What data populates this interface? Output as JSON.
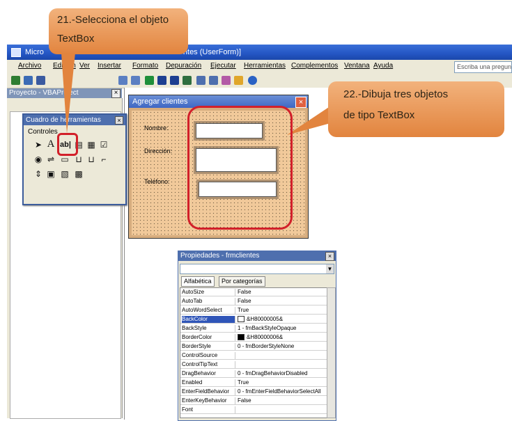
{
  "window": {
    "title": "Microsoft Visual Basic - Libro1 - [Agregar clientes (UserForm)]",
    "title_visible": "Micro",
    "title_tail": "ntes (UserForm)]"
  },
  "menu": {
    "items": [
      "Archivo",
      "Edición",
      "Ver",
      "Insertar",
      "Formato",
      "Depuración",
      "Ejecutar",
      "Herramientas",
      "Complementos",
      "Ventana",
      "Ayuda"
    ],
    "help_placeholder": "Escriba una pregunta"
  },
  "project": {
    "title": "Proyecto - VBAProject"
  },
  "toolbox": {
    "title": "Cuadro de herramientas",
    "tab": "Controles"
  },
  "form": {
    "title": "Agregar clientes",
    "labels": [
      "Nombre:",
      "Dirección:",
      "Teléfono:"
    ]
  },
  "properties": {
    "title": "Propiedades - frmclientes",
    "tabs": [
      "Alfabética",
      "Por categorías"
    ],
    "rows": [
      {
        "name": "AutoSize",
        "value": "False"
      },
      {
        "name": "AutoTab",
        "value": "False"
      },
      {
        "name": "AutoWordSelect",
        "value": "True"
      },
      {
        "name": "BackColor",
        "value": "&H80000005&"
      },
      {
        "name": "BackStyle",
        "value": "1 - fmBackStyleOpaque"
      },
      {
        "name": "BorderColor",
        "value": "&H80000006&"
      },
      {
        "name": "BorderStyle",
        "value": "0 - fmBorderStyleNone"
      },
      {
        "name": "ControlSource",
        "value": ""
      },
      {
        "name": "ControlTipText",
        "value": ""
      },
      {
        "name": "DragBehavior",
        "value": "0 - fmDragBehaviorDisabled"
      },
      {
        "name": "Enabled",
        "value": "True"
      },
      {
        "name": "EnterFieldBehavior",
        "value": "0 - fmEnterFieldBehaviorSelectAll"
      },
      {
        "name": "EnterKeyBehavior",
        "value": "False"
      },
      {
        "name": "Font",
        "value": ""
      }
    ]
  },
  "callouts": {
    "step21_line1": "21.-Selecciona el objeto",
    "step21_line2": "TextBox",
    "step22_line1": "22.-Dibuja tres objetos",
    "step22_line2": "de tipo TextBox"
  },
  "colors": {
    "highlight": "#d2202a",
    "callout": "#e98f4a",
    "form_bg": "#f1c99a"
  }
}
